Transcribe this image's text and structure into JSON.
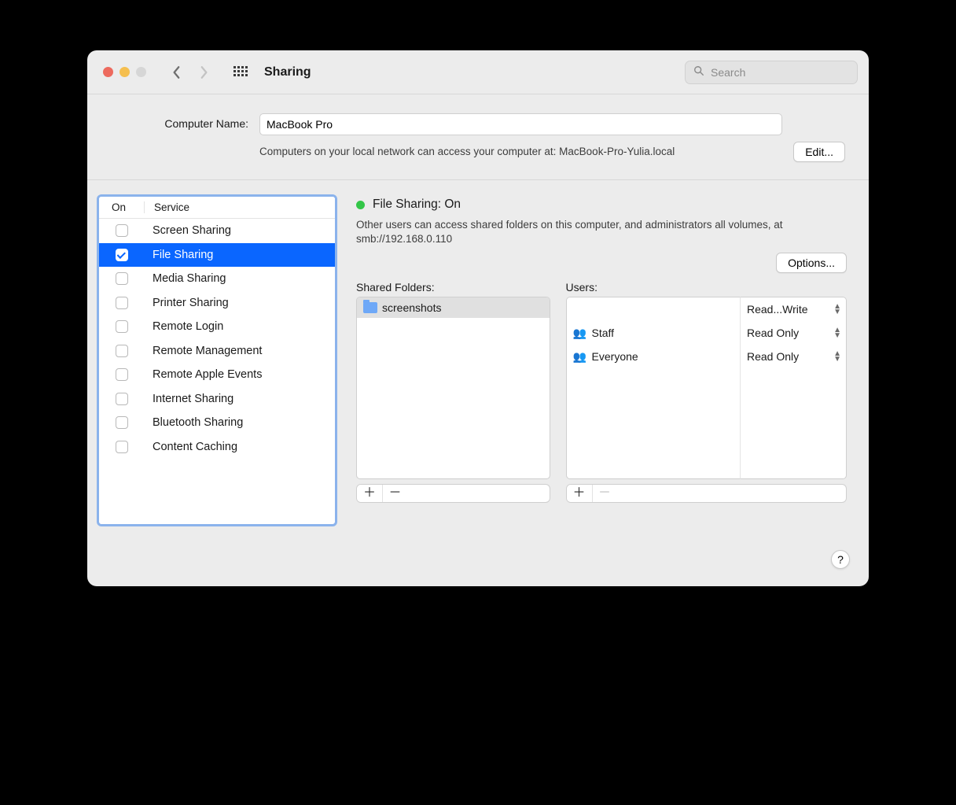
{
  "window": {
    "title": "Sharing"
  },
  "search": {
    "placeholder": "Search"
  },
  "traffic_colors": {
    "close": "#ed6a5e",
    "min": "#f5bf4f",
    "max": "#d6d6d6"
  },
  "computer_name": {
    "label": "Computer Name:",
    "value": "MacBook Pro",
    "description": "Computers on your local network can access your computer at: MacBook-Pro-Yulia.local",
    "edit_label": "Edit..."
  },
  "services": {
    "header_on": "On",
    "header_service": "Service",
    "list": [
      {
        "name": "Screen Sharing",
        "on": false,
        "selected": false
      },
      {
        "name": "File Sharing",
        "on": true,
        "selected": true
      },
      {
        "name": "Media Sharing",
        "on": false,
        "selected": false
      },
      {
        "name": "Printer Sharing",
        "on": false,
        "selected": false
      },
      {
        "name": "Remote Login",
        "on": false,
        "selected": false
      },
      {
        "name": "Remote Management",
        "on": false,
        "selected": false
      },
      {
        "name": "Remote Apple Events",
        "on": false,
        "selected": false
      },
      {
        "name": "Internet Sharing",
        "on": false,
        "selected": false
      },
      {
        "name": "Bluetooth Sharing",
        "on": false,
        "selected": false
      },
      {
        "name": "Content Caching",
        "on": false,
        "selected": false
      }
    ]
  },
  "status": {
    "color": "#33c648",
    "text": "File Sharing: On",
    "description": "Other users can access shared folders on this computer, and administrators all volumes, at smb://192.168.0.110",
    "options_label": "Options..."
  },
  "shared_folders": {
    "label": "Shared Folders:",
    "items": [
      {
        "name": "screenshots",
        "selected": true
      }
    ]
  },
  "users": {
    "label": "Users:",
    "items": [
      {
        "name": "",
        "perm": "Read...Write",
        "icon": ""
      },
      {
        "name": "Staff",
        "perm": "Read Only",
        "icon": "group"
      },
      {
        "name": "Everyone",
        "perm": "Read Only",
        "icon": "group"
      }
    ]
  },
  "help_label": "?"
}
